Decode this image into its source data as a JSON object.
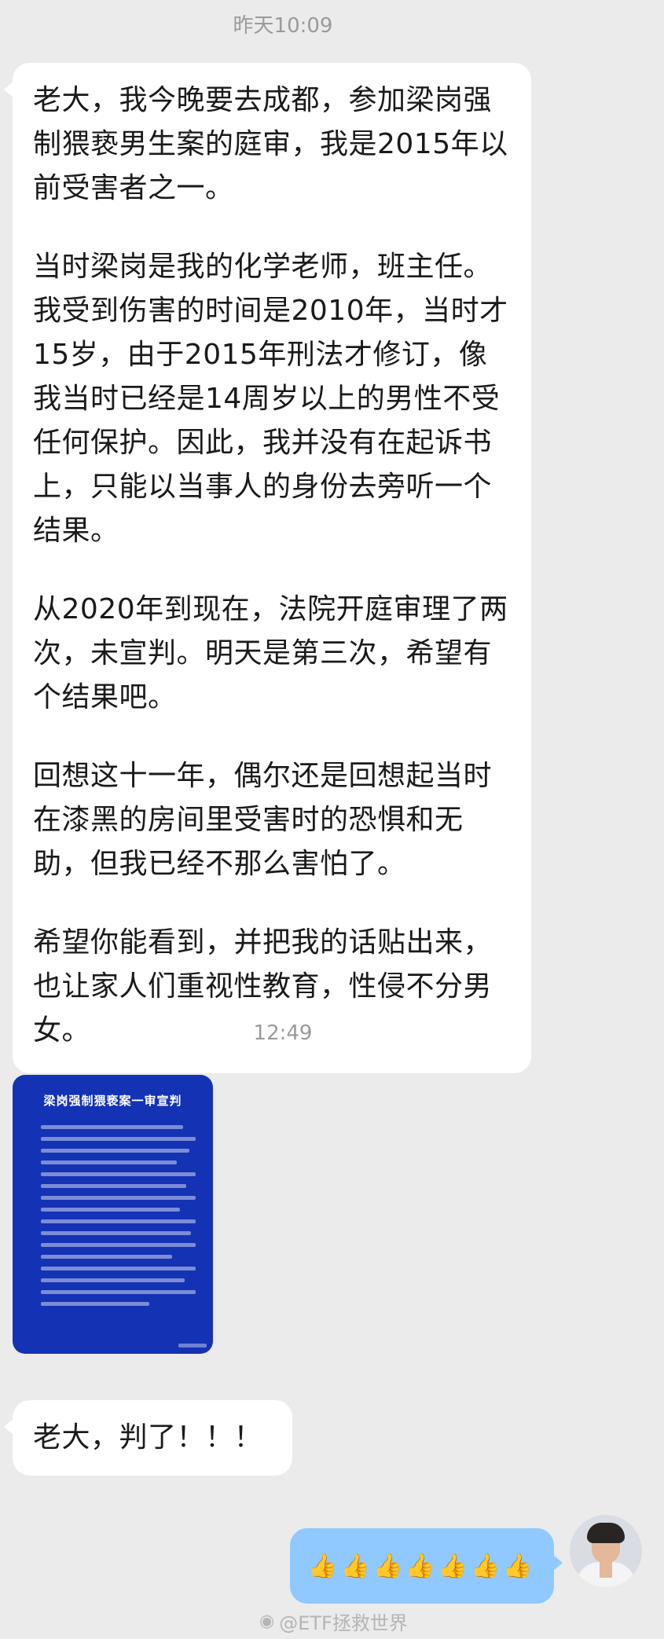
{
  "chat": {
    "time_1": "昨天10:09",
    "message_1_paragraphs": [
      "老大，我今晚要去成都，参加梁岗强制猥亵男生案的庭审，我是2015年以前受害者之一。",
      "当时梁岗是我的化学老师，班主任。我受到伤害的时间是2010年，当时才15岁，由于2015年刑法才修订，像我当时已经是14周岁以上的男性不受任何保护。因此，我并没有在起诉书上，只能以当事人的身份去旁听一个结果。",
      "从2020年到现在，法院开庭审理了两次，未宣判。明天是第三次，希望有个结果吧。",
      "回想这十一年，偶尔还是回想起当时在漆黑的房间里受害时的恐惧和无助，但我已经不那么害怕了。",
      "希望你能看到，并把我的话贴出来，也让家人们重视性教育，性侵不分男女。"
    ],
    "time_2": "12:49",
    "image_message": {
      "title": "梁岗强制猥亵案一审宣判"
    },
    "message_2": "老大，判了！！！",
    "reply": "👍👍👍👍👍👍👍"
  },
  "watermark": {
    "icon": "weibo-icon",
    "text": "@ETF拯救世界"
  }
}
